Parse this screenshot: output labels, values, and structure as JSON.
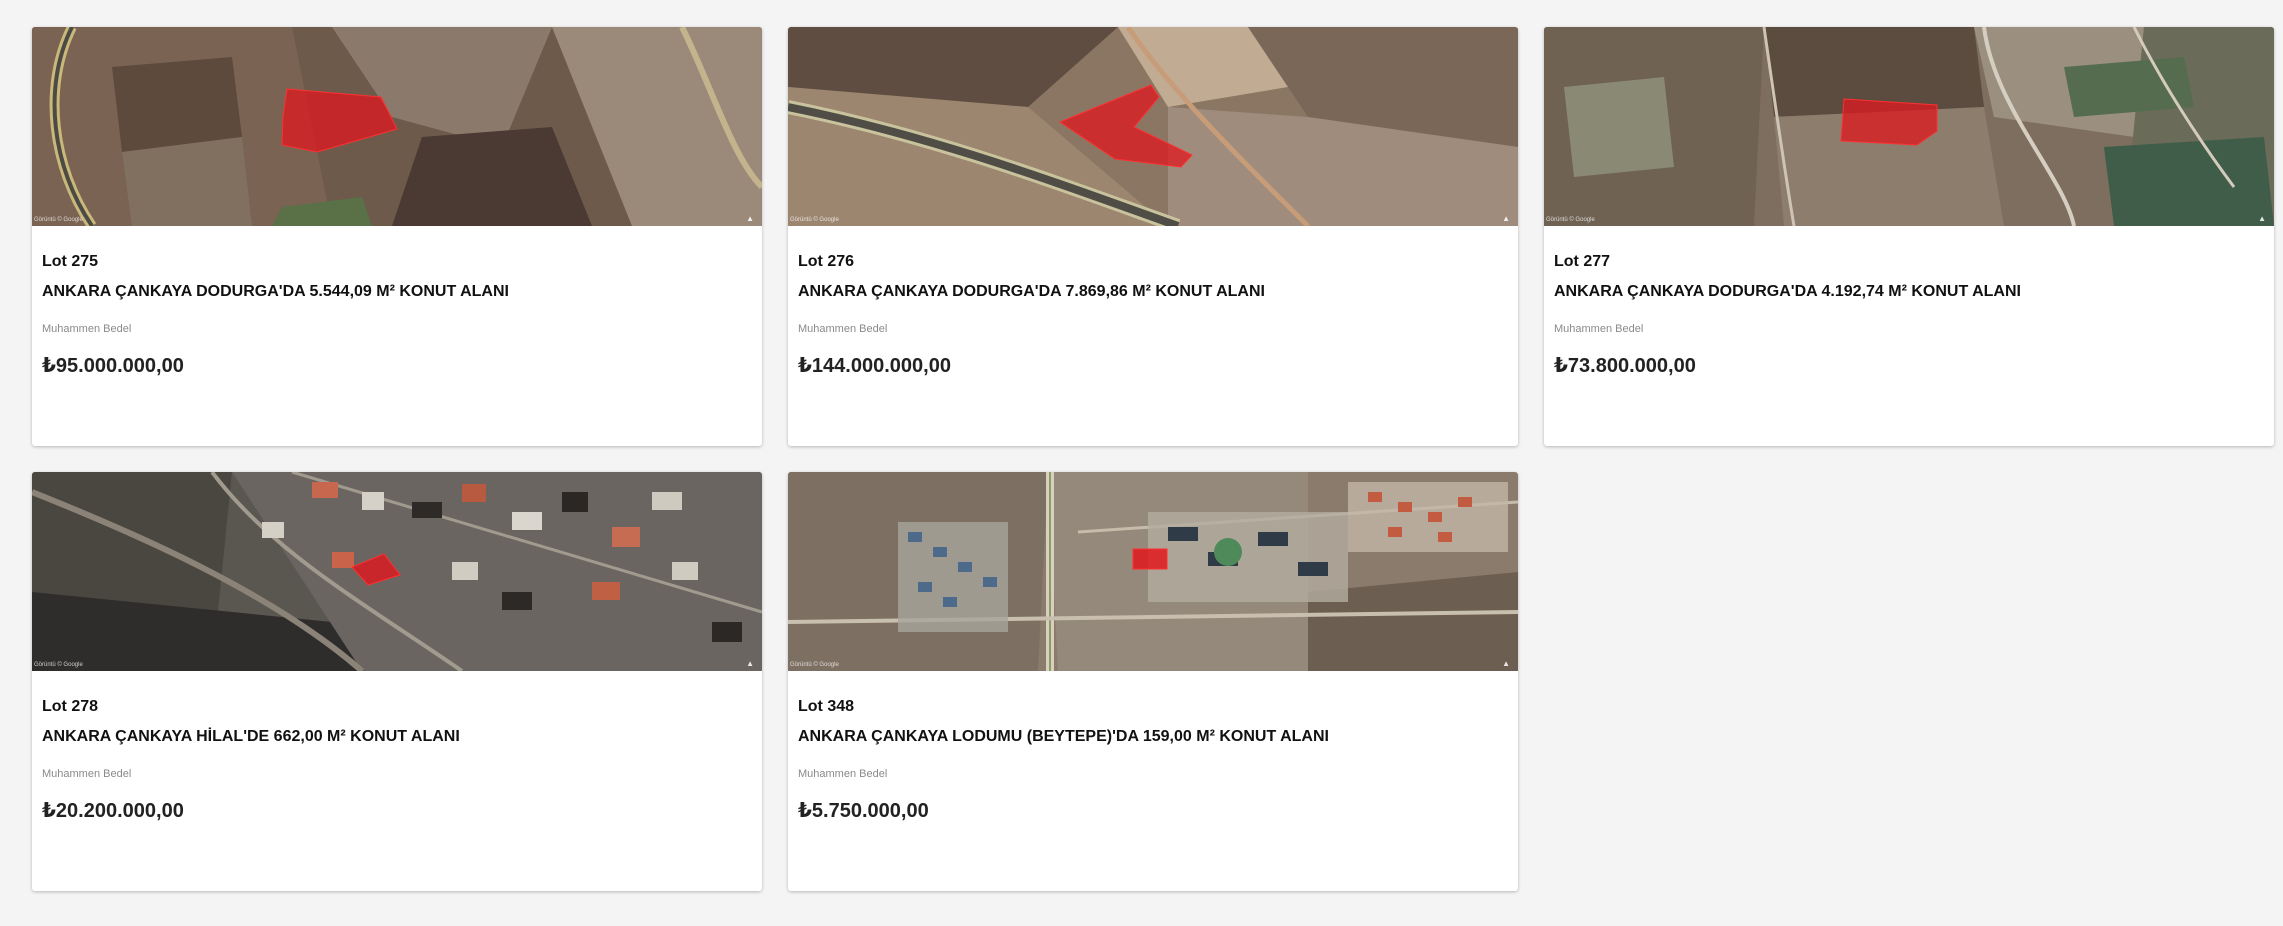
{
  "price_label": "Muhammen Bedel",
  "map_credit": "Görüntü © Google",
  "lots": [
    {
      "lot": "Lot 275",
      "title": "ANKARA ÇANKAYA DODURGA'DA 5.544,09 M² KONUT ALANI",
      "label": "Muhammen Bedel",
      "price": "₺95.000.000,00"
    },
    {
      "lot": "Lot 276",
      "title": "ANKARA ÇANKAYA DODURGA'DA 7.869,86 M² KONUT ALANI",
      "label": "Muhammen Bedel",
      "price": "₺144.000.000,00"
    },
    {
      "lot": "Lot 277",
      "title": "ANKARA ÇANKAYA DODURGA'DA 4.192,74 M² KONUT ALANI",
      "label": "Muhammen Bedel",
      "price": "₺73.800.000,00"
    },
    {
      "lot": "Lot 278",
      "title": "ANKARA ÇANKAYA HİLAL'DE 662,00 M² KONUT ALANI",
      "label": "Muhammen Bedel",
      "price": "₺20.200.000,00"
    },
    {
      "lot": "Lot 348",
      "title": "ANKARA ÇANKAYA LODUMU (BEYTEPE)'DA 159,00 M² KONUT ALANI",
      "label": "Muhammen Bedel",
      "price": "₺5.750.000,00"
    }
  ],
  "colors": {
    "background": "#f4f4f4",
    "card": "#ffffff",
    "parcel_highlight": "#e0171d"
  }
}
